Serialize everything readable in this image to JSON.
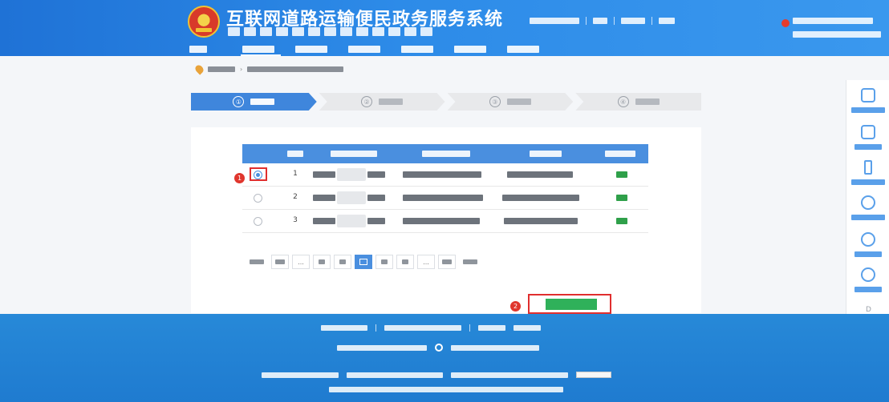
{
  "header": {
    "title": "互联网道路运输便民政务服务系统",
    "slogan": "",
    "trial_label": "",
    "top_links": [
      "",
      "",
      "",
      ""
    ],
    "portal_text": [
      "",
      ""
    ],
    "nav": [
      "",
      "",
      "",
      "",
      "",
      "",
      ""
    ],
    "active_nav_index": 1
  },
  "breadcrumb": [
    "",
    ""
  ],
  "steps": [
    {
      "num": "①",
      "label": ""
    },
    {
      "num": "②",
      "label": ""
    },
    {
      "num": "③",
      "label": ""
    },
    {
      "num": "④",
      "label": ""
    }
  ],
  "active_step_index": 0,
  "table": {
    "headers": [
      "",
      "",
      "",
      "",
      "",
      ""
    ],
    "rows": [
      {
        "selected": true,
        "index": "1",
        "cert_no": "",
        "business_scope": "",
        "issuing_authority": "",
        "status": ""
      },
      {
        "selected": false,
        "index": "2",
        "cert_no": "",
        "business_scope": "",
        "issuing_authority": "",
        "status": ""
      },
      {
        "selected": false,
        "index": "3",
        "cert_no": "",
        "business_scope": "",
        "issuing_authority": "",
        "status": ""
      }
    ]
  },
  "pagination": {
    "items": [
      "",
      "",
      "...",
      "",
      "",
      "",
      "",
      "",
      "...",
      "",
      ""
    ],
    "active_index": 5
  },
  "markers": [
    "1",
    "2"
  ],
  "next_button": "",
  "side_tools": [
    "",
    "",
    "",
    "",
    "",
    ""
  ],
  "footer": {
    "links": [
      "",
      "",
      "",
      ""
    ],
    "sponsor": "",
    "icp": "",
    "gov_record": "",
    "tech_support": "",
    "browser_note": ""
  },
  "colors": {
    "header_blue": "#2d8be8",
    "active_blue": "#4a8fdf",
    "success_green": "#2fb15a",
    "highlight_red": "#e02e2e",
    "footer_blue": "#2789d8"
  }
}
